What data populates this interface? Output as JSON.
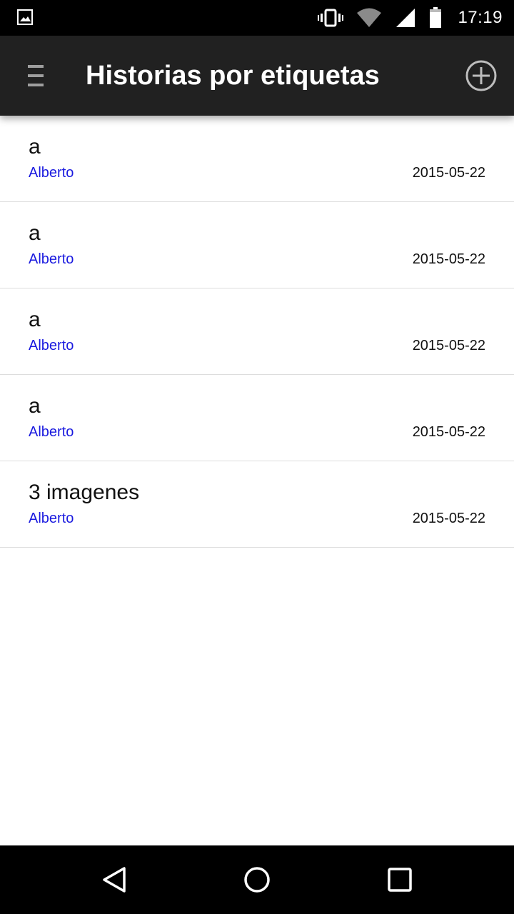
{
  "status_bar": {
    "time": "17:19",
    "icons": [
      "image-notification-icon",
      "vibrate-icon",
      "wifi-icon",
      "cell-signal-icon",
      "battery-icon"
    ]
  },
  "app_bar": {
    "title": "Historias por etiquetas",
    "menu_icon": "menu-icon",
    "add_icon": "add-circle-icon"
  },
  "stories": [
    {
      "title": "a",
      "author": "Alberto",
      "date": "2015-05-22"
    },
    {
      "title": "a",
      "author": "Alberto",
      "date": "2015-05-22"
    },
    {
      "title": "a",
      "author": "Alberto",
      "date": "2015-05-22"
    },
    {
      "title": "a",
      "author": "Alberto",
      "date": "2015-05-22"
    },
    {
      "title": "3 imagenes",
      "author": "Alberto",
      "date": "2015-05-22"
    }
  ],
  "nav_bar": {
    "icons": [
      "back-icon",
      "home-icon",
      "recents-icon"
    ]
  },
  "colors": {
    "app_bar": "#212121",
    "author_link": "#1a1adf",
    "divider": "#dddddd"
  }
}
